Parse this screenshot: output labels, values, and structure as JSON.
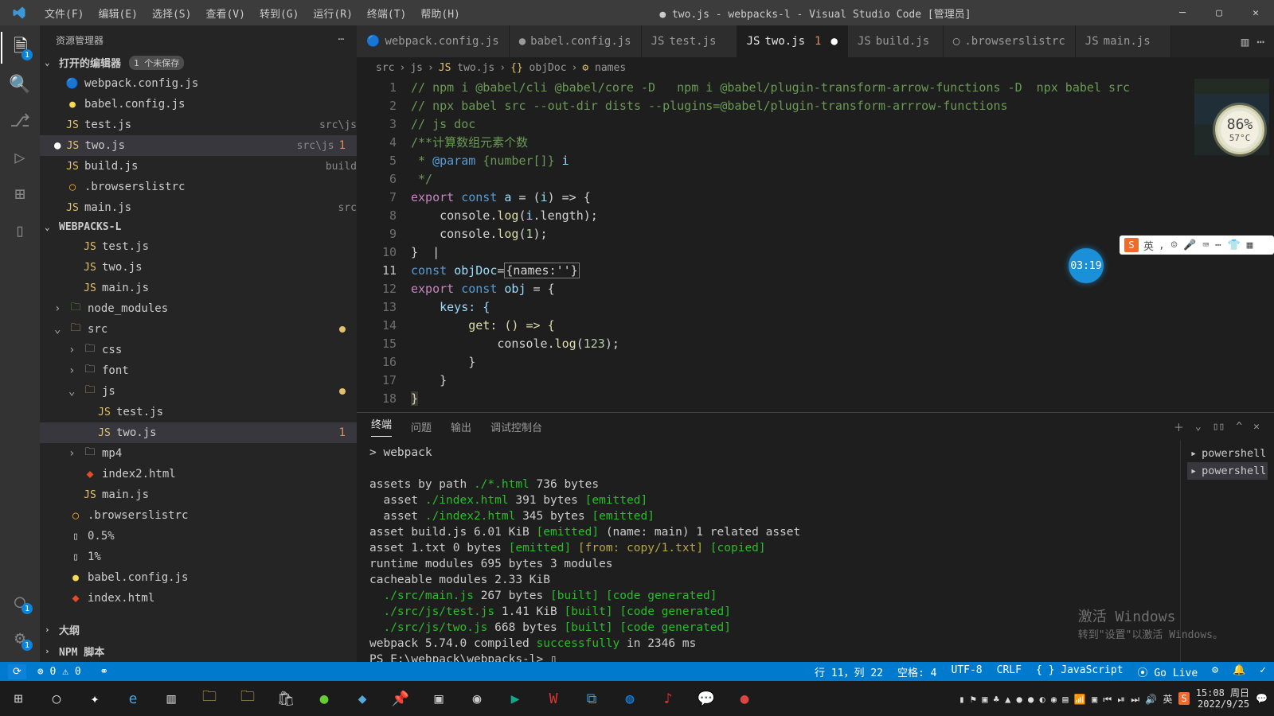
{
  "title": "● two.js - webpacks-l - Visual Studio Code [管理员]",
  "menus": [
    "文件(F)",
    "编辑(E)",
    "选择(S)",
    "查看(V)",
    "转到(G)",
    "运行(R)",
    "终端(T)",
    "帮助(H)"
  ],
  "sidebar": {
    "title": "资源管理器",
    "openEditors": {
      "label": "打开的编辑器",
      "badge": "1 个未保存"
    },
    "open": [
      {
        "icon": "🔵",
        "cls": "ic-wp",
        "name": "webpack.config.js"
      },
      {
        "icon": "●",
        "cls": "ic-bb",
        "name": "babel.config.js"
      },
      {
        "icon": "JS",
        "cls": "ic-js",
        "name": "test.js",
        "sub": "src\\js"
      },
      {
        "icon": "JS",
        "cls": "ic-js",
        "name": "two.js",
        "sub": "src\\js",
        "num": "1",
        "dirty": true,
        "active": true
      },
      {
        "icon": "JS",
        "cls": "ic-js",
        "name": "build.js",
        "sub": "build"
      },
      {
        "icon": "◯",
        "cls": "ic-brw",
        "name": ".browserslistrc"
      },
      {
        "icon": "JS",
        "cls": "ic-js",
        "name": "main.js",
        "sub": "src"
      }
    ],
    "project": "WEBPACKS-L",
    "tree": [
      {
        "ind": 1,
        "icon": "JS",
        "cls": "ic-js",
        "name": "test.js"
      },
      {
        "ind": 1,
        "icon": "JS",
        "cls": "ic-js",
        "name": "two.js"
      },
      {
        "ind": 1,
        "icon": "JS",
        "cls": "ic-js",
        "name": "main.js"
      },
      {
        "ind": 0,
        "chev": "›",
        "icon": "🗀",
        "cls": "ic-fold-g",
        "name": "node_modules"
      },
      {
        "ind": 0,
        "chev": "⌄",
        "icon": "🗀",
        "cls": "ic-fold",
        "name": "src",
        "dot": true
      },
      {
        "ind": 1,
        "chev": "›",
        "icon": "🗀",
        "cls": "",
        "name": "css"
      },
      {
        "ind": 1,
        "chev": "›",
        "icon": "🗀",
        "cls": "",
        "name": "font"
      },
      {
        "ind": 1,
        "chev": "⌄",
        "icon": "🗀",
        "cls": "ic-fold",
        "name": "js",
        "dot": true
      },
      {
        "ind": 2,
        "icon": "JS",
        "cls": "ic-js",
        "name": "test.js"
      },
      {
        "ind": 2,
        "icon": "JS",
        "cls": "ic-js",
        "name": "two.js",
        "num": "1",
        "active": true
      },
      {
        "ind": 1,
        "chev": "›",
        "icon": "🗀",
        "cls": "",
        "name": "mp4"
      },
      {
        "ind": 1,
        "icon": "⬥",
        "cls": "ic-html",
        "name": "index2.html"
      },
      {
        "ind": 1,
        "icon": "JS",
        "cls": "ic-js",
        "name": "main.js"
      },
      {
        "ind": 0,
        "icon": "◯",
        "cls": "ic-brw",
        "name": ".browserslistrc"
      },
      {
        "ind": 0,
        "icon": "▯",
        "cls": "",
        "name": "0.5%"
      },
      {
        "ind": 0,
        "icon": "▯",
        "cls": "",
        "name": "1%"
      },
      {
        "ind": 0,
        "icon": "●",
        "cls": "ic-bb",
        "name": "babel.config.js"
      },
      {
        "ind": 0,
        "icon": "⬥",
        "cls": "ic-html",
        "name": "index.html"
      }
    ],
    "outline": "大纲",
    "npm": "NPM 脚本"
  },
  "tabs": [
    {
      "icon": "🔵",
      "label": "webpack.config.js"
    },
    {
      "icon": "●",
      "label": "babel.config.js"
    },
    {
      "icon": "JS",
      "label": "test.js"
    },
    {
      "icon": "JS",
      "label": "two.js",
      "num": "1",
      "dirty": true,
      "active": true
    },
    {
      "icon": "JS",
      "label": "build.js"
    },
    {
      "icon": "◯",
      "label": ".browserslistrc"
    },
    {
      "icon": "JS",
      "label": "main.js"
    }
  ],
  "breadcrumb": [
    "src",
    "js",
    "two.js",
    "objDoc",
    "names"
  ],
  "bcicons": [
    "",
    "",
    "JS",
    "{}",
    "⚙"
  ],
  "code": {
    "lines": 18,
    "cur": 11,
    "l1a": "// npm i @babel/cli @babel/core -D   npm i @babel/plugin-transform-arrow-functions -D  npx babel src",
    "l2": "// npx babel src --out-dir dists --plugins=@babel/plugin-transform-arrrow-functions",
    "l3": "// js doc",
    "l4": "/**计算数组元素个数",
    "l5a": " * ",
    "l5b": "@param",
    "l5c": " {number[]} ",
    "l5d": "i",
    "l6": " */",
    "l7_exp": "export ",
    "l7_cn": "const ",
    "l7_v": "a",
    "l7_eq": " = (",
    "l7_i": "i",
    "l7_ar": ") => {",
    "l8a": "    console.",
    "l8b": "log",
    "l8c": "(",
    "l8d": "i",
    "l8e": ".length);",
    "l9a": "    console.",
    "l9b": "log",
    "l9c": "(",
    "l9d": "1",
    "l9e": ");",
    "l10": "}  ",
    "l10c": "[",
    "l11a": "const ",
    "l11b": "objDoc",
    "l11c": "=",
    "l11box": "{names:''}",
    "l12a": "export ",
    "l12b": "const ",
    "l12c": "obj",
    "l12d": " = {",
    "l13": "    keys: {",
    "l14": "        get: () => {",
    "l15a": "            console.",
    "l15b": "log",
    "l15c": "(",
    "l15d": "123",
    "l15e": ");",
    "l16": "        }",
    "l17": "    }",
    "l18": "}"
  },
  "panel": {
    "tabs": [
      "终端",
      "问题",
      "输出",
      "调试控制台"
    ],
    "shells": [
      "powershell",
      "powershell"
    ],
    "text": "> webpack\n\nassets by path ./*.html 736 bytes\n  asset ./index.html 391 bytes [emitted]\n  asset ./index2.html 345 bytes [emitted]\nasset build.js 6.01 KiB [emitted] (name: main) 1 related asset\nasset 1.txt 0 bytes [emitted] [from: copy/1.txt] [copied]\nruntime modules 695 bytes 3 modules\ncacheable modules 2.33 KiB\n  ./src/main.js 267 bytes [built] [code generated]\n  ./src/js/test.js 1.41 KiB [built] [code generated]\n  ./src/js/two.js 668 bytes [built] [code generated]\nwebpack 5.74.0 compiled successfully in 2346 ms\nPS E:\\webpack\\webpacks-l> ▯"
  },
  "status": {
    "left": [
      "⊗ 0 ⚠ 0",
      "⚭"
    ],
    "right": [
      "行 11，列 22",
      "空格: 4",
      "UTF-8",
      "CRLF",
      "{ } JavaScript",
      "⦿ Go Live",
      "⚙",
      "🔔",
      "✓"
    ]
  },
  "gauge": {
    "pct": "86%",
    "temp": "57°C"
  },
  "timer": "03:19",
  "watermark": {
    "a": "激活 Windows",
    "b": "转到\"设置\"以激活 Windows。"
  },
  "clock": {
    "t": "15:08 周日",
    "d": "2022/9/25"
  }
}
